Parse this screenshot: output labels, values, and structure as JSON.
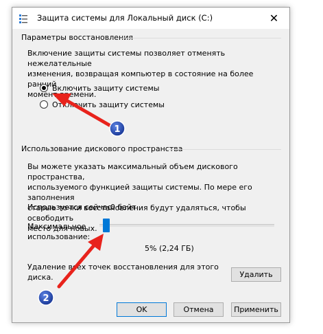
{
  "window": {
    "title": "Защита системы для Локальный диск (C:)",
    "close_symbol": "✕"
  },
  "restore_settings": {
    "header": "Параметры восстановления",
    "description_lines": [
      "Включение защиты системы позволяет отменять нежелательные",
      "изменения, возвращая компьютер в состояние на более ранний",
      "момент времени."
    ],
    "options": [
      {
        "label": "Включить защиту системы",
        "checked": true
      },
      {
        "label": "Отключить защиту системы",
        "checked": false
      }
    ]
  },
  "disk_usage": {
    "header": "Использование дискового пространства",
    "description_lines": [
      "Вы можете указать максимальный объем дискового пространства,",
      "используемого функцией защиты системы. По мере его заполнения",
      "старые точки восстановления будут удаляться, чтобы освободить",
      "место для новых."
    ],
    "current_usage_label": "Используется сейчас:",
    "current_usage_value": "0 байт",
    "max_usage_label_lines": [
      "Максимальное",
      "использование:"
    ],
    "slider_percent": 5,
    "slider_value_text": "5% (2,24 ГБ)",
    "delete_text_lines": [
      "Удаление всех точек восстановления для этого",
      "диска."
    ],
    "delete_button": "Удалить"
  },
  "footer": {
    "ok": "OK",
    "cancel": "Отмена",
    "apply": "Применить"
  },
  "annotations": {
    "badge_1": "1",
    "badge_2": "2",
    "arrow_color": "#e8231c",
    "badge_color": "#1a3fa8"
  }
}
